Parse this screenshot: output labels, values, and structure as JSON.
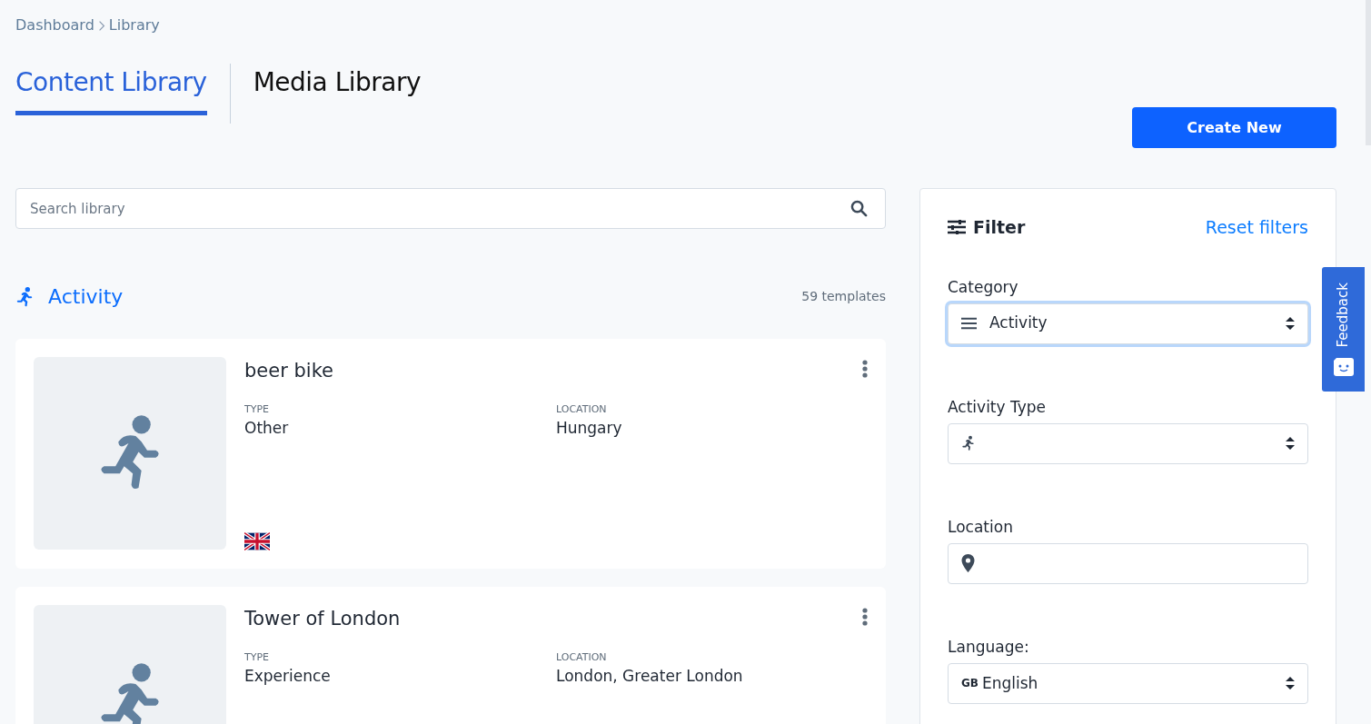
{
  "breadcrumb": [
    {
      "label": "Dashboard"
    },
    {
      "label": "Library"
    }
  ],
  "tabs": [
    {
      "label": "Content Library",
      "selected": true
    },
    {
      "label": "Media Library",
      "selected": false
    }
  ],
  "create_button": "Create New",
  "search": {
    "placeholder": "Search library"
  },
  "section": {
    "title": "Activity",
    "count": "59 templates"
  },
  "templates": [
    {
      "title": "beer bike",
      "type_label": "TYPE",
      "type": "Other",
      "location_label": "LOCATION",
      "location": "Hungary"
    },
    {
      "title": "Tower of London",
      "type_label": "TYPE",
      "type": "Experience",
      "location_label": "LOCATION",
      "location": "London, Greater London"
    }
  ],
  "filter": {
    "title": "Filter",
    "reset": "Reset filters",
    "fields": [
      {
        "kind": "select",
        "label": "Category",
        "value": "Activity",
        "focused": true
      },
      {
        "kind": "select",
        "label": "Activity Type",
        "focused": false
      },
      {
        "kind": "input",
        "label": "Location",
        "focused": false
      },
      {
        "kind": "select",
        "label": "Language:",
        "code": "GB",
        "value": "English",
        "focused": false
      }
    ]
  },
  "feedback": "Feedback"
}
